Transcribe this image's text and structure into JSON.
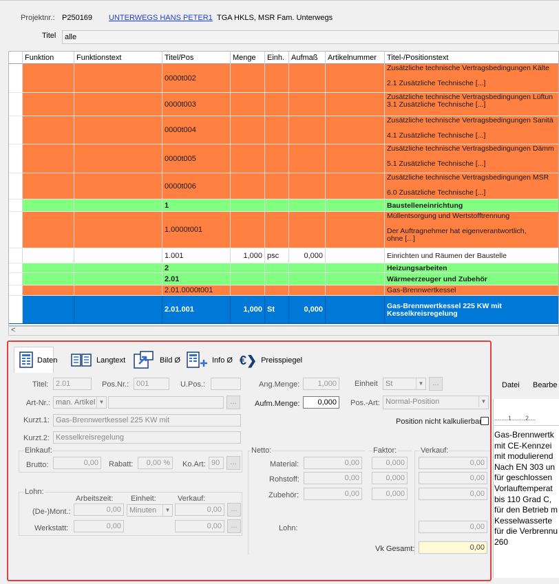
{
  "header": {
    "projekt_label": "Projektnr.:",
    "projekt_nr": "P250169",
    "projekt_link": "UNTERWEGS HANS PETER1",
    "projekt_desc": "TGA HKLS, MSR Fam. Unterwegs",
    "titel_label": "Titel",
    "titel_value": "alle"
  },
  "grid": {
    "columns": [
      "Funktion",
      "Funktionstext",
      "Titel/Pos",
      "Menge",
      "Einh.",
      "Aufmaß",
      "Artikelnummer",
      "Titel-/Positionstext"
    ],
    "rows": [
      {
        "pos": "0000t002",
        "menge": "",
        "einh": "",
        "aufmass": "",
        "text": "Zusätzliche technische Vertragsbedingungen Kälte\n\n2.1 Zusätzliche Technische [...]"
      },
      {
        "pos": "0000t003",
        "menge": "",
        "einh": "",
        "aufmass": "",
        "text": "Zusätzliche technische Vertragsbedingungen Lüftun\n3.1 Zusätzliche Technische [...]"
      },
      {
        "pos": "0000t004",
        "menge": "",
        "einh": "",
        "aufmass": "",
        "text": "Zusätzliche technische Vertragsbedingungen Sanitä\n\n4.1 Zusätzliche Technische [...]"
      },
      {
        "pos": "0000t005",
        "menge": "",
        "einh": "",
        "aufmass": "",
        "text": "Zusätzliche technische Vertragsbedingungen Dämm\n\n5.1 Zusätzliche Technische [...]"
      },
      {
        "pos": "0000t006",
        "menge": "",
        "einh": "",
        "aufmass": "",
        "text": "Zusätzliche technische Vertragsbedingungen MSR\n\n6.0 Zusätzliche Technische [...]"
      },
      {
        "pos": "1",
        "menge": "",
        "einh": "",
        "aufmass": "",
        "text": "Baustelleneinrichtung"
      },
      {
        "pos": "1.0000t001",
        "menge": "",
        "einh": "",
        "aufmass": "",
        "text": "Müllentsorgung und Wertstofftrennung\n\nDer Auftragnehmer hat eigenverantwortlich,\nohne [...]"
      },
      {
        "pos": "1.001",
        "menge": "1,000",
        "einh": "psc",
        "aufmass": "0,000",
        "text": "Einrichten und Räumen der Baustelle"
      },
      {
        "pos": "2",
        "menge": "",
        "einh": "",
        "aufmass": "",
        "text": "Heizungsarbeiten"
      },
      {
        "pos": "2.01",
        "menge": "",
        "einh": "",
        "aufmass": "",
        "text": "Wärmeerzeuger und Zubehör"
      },
      {
        "pos": "2.01.0000t001",
        "menge": "",
        "einh": "",
        "aufmass": "",
        "text": "Gas-Brennwertkessel"
      },
      {
        "pos": "2.01.001",
        "menge": "1,000",
        "einh": "St",
        "aufmass": "0,000",
        "text": "Gas-Brennwertkessel 225 KW mit\nKesselkreisregelung"
      }
    ]
  },
  "tabs": [
    "Daten",
    "Langtext",
    "Bild Ø",
    "Info Ø",
    "Preisspiegel"
  ],
  "form": {
    "titel_label": "Titel:",
    "titel": "2.01",
    "posnr_label": "Pos.Nr.:",
    "posnr": "001",
    "upos_label": "U.Pos.:",
    "upos": "",
    "artnr_label": "Art-Nr.:",
    "artnr": "man. Artikel",
    "kurzt1_label": "Kurzt.1:",
    "kurzt1": "Gas-Brennwertkessel 225 KW mit",
    "kurzt2_label": "Kurzt.2:",
    "kurzt2": "Kesselkreisregelung",
    "angmenge_label": "Ang.Menge:",
    "angmenge": "1,000",
    "einheit_label": "Einheit",
    "einheit": "St",
    "aufmmenge_label": "Aufm.Menge:",
    "aufmmenge": "0,000",
    "posart_label": "Pos.-Art:",
    "posart": "Normal-Position",
    "nicht_kalk_label": "Position nicht kalkulierbar",
    "einkauf_label": "Einkauf:",
    "brutto_label": "Brutto:",
    "brutto": "0,00",
    "rabatt_label": "Rabatt:",
    "rabatt": "0,00 %",
    "koart_label": "Ko.Art:",
    "koart": "90",
    "lohn_label": "Lohn:",
    "arbeitszeit_label": "Arbeitszeit:",
    "einheit2_label": "Einheit:",
    "verkauf2_label": "Verkauf:",
    "demont_label": "(De-)Mont.:",
    "demont_az": "0,00",
    "demont_einheit": "Minuten",
    "demont_vk": "0,00",
    "werkstatt_label": "Werkstatt:",
    "werkstatt_az": "0,00",
    "werkstatt_vk": "0,00",
    "netto_label": "Netto:",
    "faktor_label": "Faktor:",
    "verkauf_label": "Verkauf:",
    "material_label": "Material:",
    "material_netto": "0,00",
    "material_faktor": "0,000",
    "material_vk": "0,00",
    "rohstoff_label": "Rohstoff:",
    "rohstoff_netto": "0,00",
    "rohstoff_faktor": "0,000",
    "rohstoff_vk": "0,00",
    "zubehoer_label": "Zubehör:",
    "zubehoer_netto": "0,00",
    "zubehoer_faktor": "0,000",
    "zubehoer_vk": "0,00",
    "lohn2_label": "Lohn:",
    "lohn_vk": "0,00",
    "vkgesamt_label": "Vk Gesamt:",
    "vkgesamt": "0,00"
  },
  "side": {
    "menu": [
      "Datei",
      "Bearbe"
    ],
    "ruler": "........1........2....",
    "text": "Gas-Brennwertk\nmit CE-Kennzei\nmit modulierend\nNach EN 303 un\nfür geschlossen\nVorlauftemperat\nbis 110 Grad C,\nfür den Betrieb m\nKesselwasserte\nfür die Verbrennu\n260"
  },
  "colors": {
    "orange": "#ff8040",
    "green": "#80ff80",
    "blue": "#0078d7",
    "highlight": "#e04040"
  }
}
